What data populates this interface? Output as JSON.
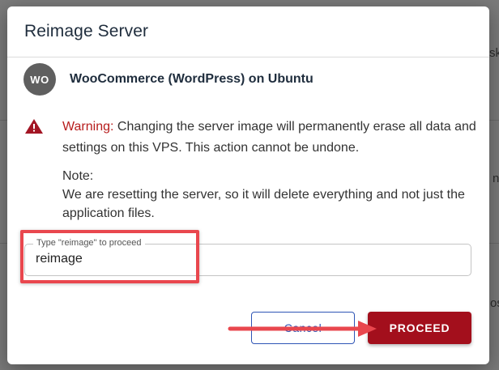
{
  "backdrop": {
    "right_edge_text_1": "sk",
    "right_edge_text_2": "n",
    "right_edge_text_3": "os"
  },
  "modal": {
    "title": "Reimage Server",
    "app": {
      "avatar_initials": "WO",
      "name": "WooCommerce (WordPress) on Ubuntu"
    },
    "warning": {
      "icon": "warning-triangle-icon",
      "label": "Warning:",
      "message": "Changing the server image will permanently erase all data and settings on this VPS. This action cannot be undone."
    },
    "note": {
      "heading": "Note:",
      "message": "We are resetting the server, so it will delete everything and not just the application files."
    },
    "confirm_field": {
      "label": "Type \"reimage\" to proceed",
      "value": "reimage"
    },
    "buttons": {
      "cancel_label": "Cancel",
      "proceed_label": "PROCEED"
    }
  },
  "colors": {
    "warning_red": "#b71c1c",
    "proceed_button": "#a30f1c",
    "cancel_border": "#2f55b5",
    "highlight": "#e9474e",
    "avatar_bg": "#5f5f5f"
  }
}
